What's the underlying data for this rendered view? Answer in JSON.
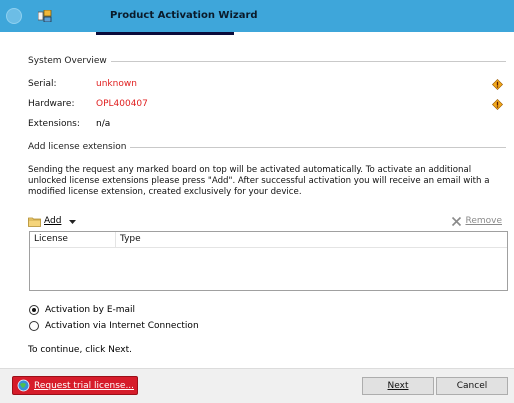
{
  "window": {
    "title": "Product Activation Wizard"
  },
  "system_overview": {
    "heading": "System Overview",
    "serial": {
      "label": "Serial:",
      "value": "unknown"
    },
    "hardware": {
      "label": "Hardware:",
      "value": "OPL400407"
    },
    "extensions": {
      "label": "Extensions:",
      "value": "n/a"
    }
  },
  "add_license": {
    "heading": "Add license extension",
    "description": "Sending the request any marked board on top will be activated automatically. To activate an additional unlocked license extensions please press \"Add\". After successful activation you will receive an email with a modified license extension, created exclusively for your device.",
    "add_label": "Add",
    "remove_label": "Remove",
    "columns": [
      "License",
      "Type"
    ]
  },
  "activation": {
    "options": [
      "Activation by E-mail",
      "Activation via Internet Connection"
    ],
    "selected_index": 0
  },
  "continue_text": "To continue, click Next.",
  "footer": {
    "trial_label": "Request trial license...",
    "next_label": "Next",
    "cancel_label": "Cancel"
  },
  "colors": {
    "titlebar": "#3ea6da",
    "warning_value": "#e02020",
    "trial_button": "#d61c2a"
  },
  "icons": [
    "app-icon",
    "warning-icon",
    "folder-add-icon",
    "dropdown-arrow-icon",
    "remove-x-icon",
    "trial-globe-icon"
  ]
}
